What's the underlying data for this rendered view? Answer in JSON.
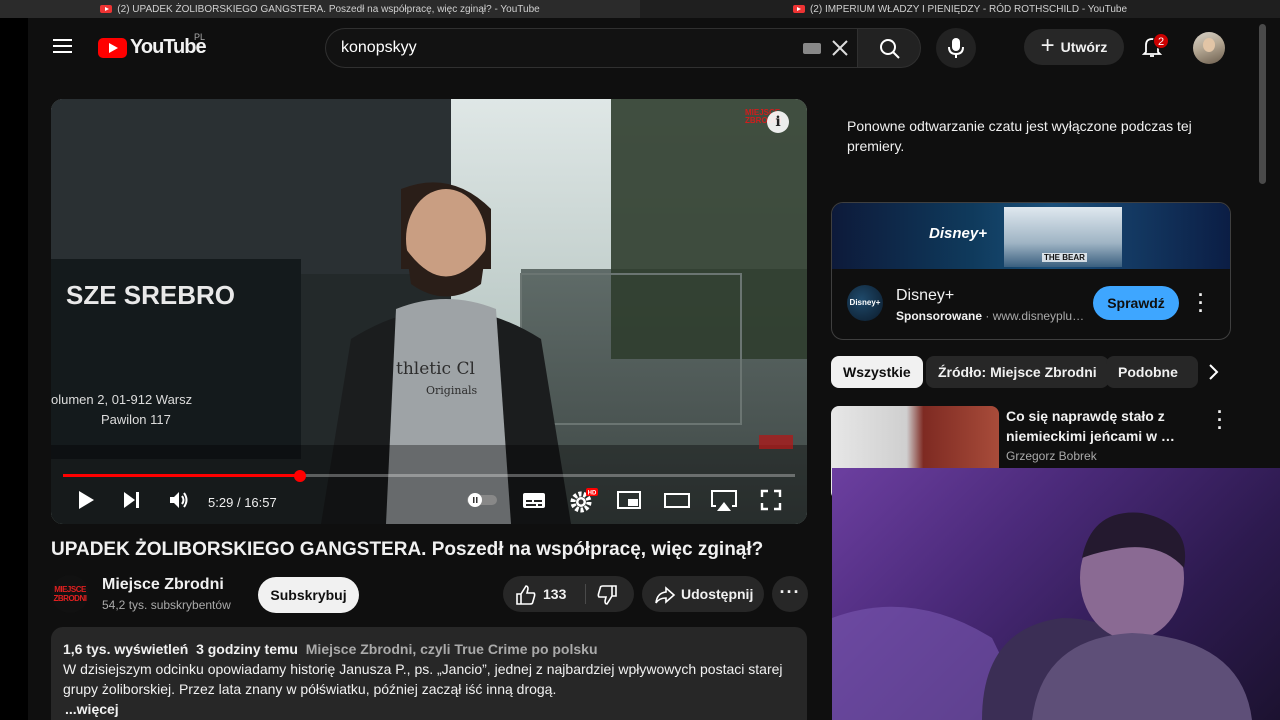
{
  "window_tabs": [
    {
      "title": "(2) UPADEK ŻOLIBORSKIEGO GANGSTERA. Poszedł na współpracę, więc zginął? - YouTube"
    },
    {
      "title": "(2) IMPERIUM WŁADZY I PIENIĘDZY - RÓD ROTHSCHILD - YouTube"
    }
  ],
  "masthead": {
    "logo_text": "YouTube",
    "region": "PL",
    "search_value": "konopskyy",
    "create_label": "Utwórz",
    "notifications_count": "2"
  },
  "player": {
    "time_current": "5:29",
    "time_separator": "/",
    "time_total": "16:57",
    "progress": 0.324,
    "watermark": "MIEJSCE ZBRODNI",
    "info": "i"
  },
  "video": {
    "title": "UPADEK ŻOLIBORSKIEGO GANGSTERA. Poszedł na współpracę, więc zginął?",
    "channel_name": "Miejsce Zbrodni",
    "channel_avatar_text": "MIEJSCE ZBRODNI",
    "subscribers": "54,2 tys. subskrybentów",
    "subscribe_label": "Subskrybuj",
    "likes": "133",
    "share_label": "Udostępnij",
    "more_label": "···"
  },
  "description": {
    "views": "1,6 tys. wyświetleń",
    "time_ago": "3 godziny temu",
    "hashtag": "Miejsce Zbrodni, czyli True Crime po polsku",
    "text": "W dzisiejszym odcinku opowiadamy historię Janusza P., ps. „Jancio”, jednej z najbardziej wpływowych postaci starej grupy żoliborskiej. Przez lata znany w półświatku, później zaczął iść inną drogą.",
    "more": "...więcej"
  },
  "chat_note": "Ponowne odtwarzanie czatu jest wyłączone podczas tej premiery.",
  "ad": {
    "banner_brand": "Disney+",
    "thumb_label": "THE BEAR",
    "logo_text": "Disney+",
    "name": "Disney+",
    "sponsored": "Sponsorowane",
    "dot": "·",
    "url": "www.disneyplu…",
    "cta": "Sprawdź"
  },
  "chips": [
    "Wszystkie",
    "Źródło: Miejsce Zbrodni",
    "Podobne"
  ],
  "recommendation": {
    "title": "Co się naprawdę stało z niemieckimi jeńcami w …",
    "channel": "Grzegorz Bobrek"
  },
  "colors": {
    "accent_red": "#ff0000",
    "cta_blue": "#3ea6ff",
    "background": "#0f0f0f"
  }
}
